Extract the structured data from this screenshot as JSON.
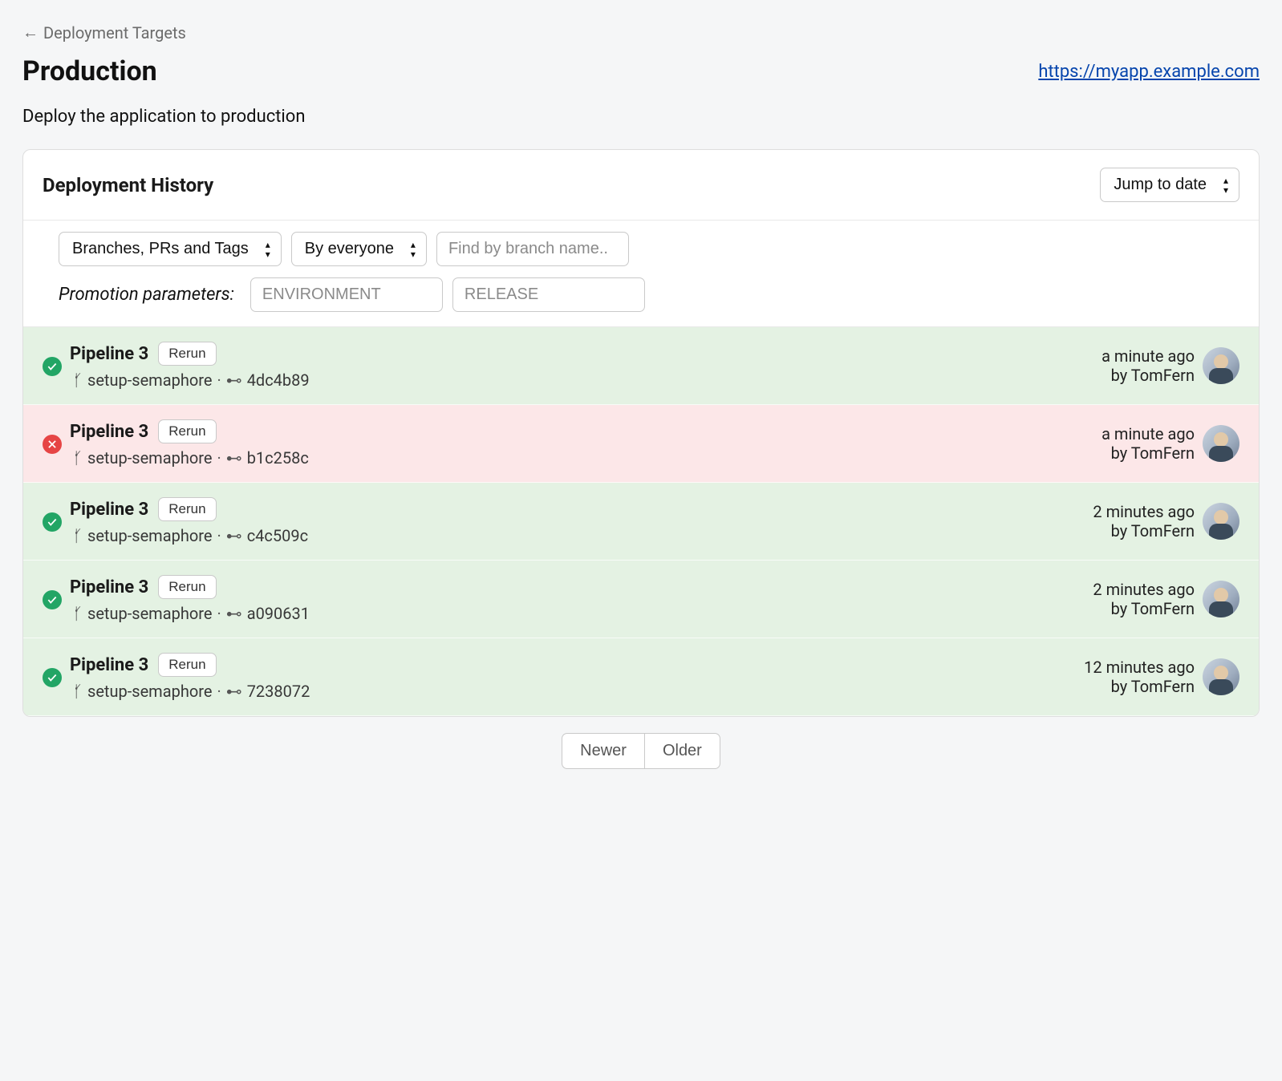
{
  "breadcrumb": {
    "back_arrow": "←",
    "label": "Deployment Targets"
  },
  "page_title": "Production",
  "target_url": "https://myapp.example.com",
  "description": "Deploy the application to production",
  "section_title": "Deployment History",
  "jump_to_date_label": "Jump to date",
  "filters": {
    "source_label": "Branches, PRs and Tags",
    "author_label": "By everyone",
    "search_placeholder": "Find by branch name.."
  },
  "params": {
    "label": "Promotion parameters:",
    "env_placeholder": "ENVIRONMENT",
    "release_placeholder": "RELEASE"
  },
  "rerun_label": "Rerun",
  "deployments": [
    {
      "status": "success",
      "pipeline": "Pipeline 3",
      "branch": "setup-semaphore",
      "commit": "4dc4b89",
      "time": "a minute ago",
      "author": "by TomFern"
    },
    {
      "status": "failed",
      "pipeline": "Pipeline 3",
      "branch": "setup-semaphore",
      "commit": "b1c258c",
      "time": "a minute ago",
      "author": "by TomFern"
    },
    {
      "status": "success",
      "pipeline": "Pipeline 3",
      "branch": "setup-semaphore",
      "commit": "c4c509c",
      "time": "2 minutes ago",
      "author": "by TomFern"
    },
    {
      "status": "success",
      "pipeline": "Pipeline 3",
      "branch": "setup-semaphore",
      "commit": "a090631",
      "time": "2 minutes ago",
      "author": "by TomFern"
    },
    {
      "status": "success",
      "pipeline": "Pipeline 3",
      "branch": "setup-semaphore",
      "commit": "7238072",
      "time": "12 minutes ago",
      "author": "by TomFern"
    }
  ],
  "pagination": {
    "newer": "Newer",
    "older": "Older"
  }
}
